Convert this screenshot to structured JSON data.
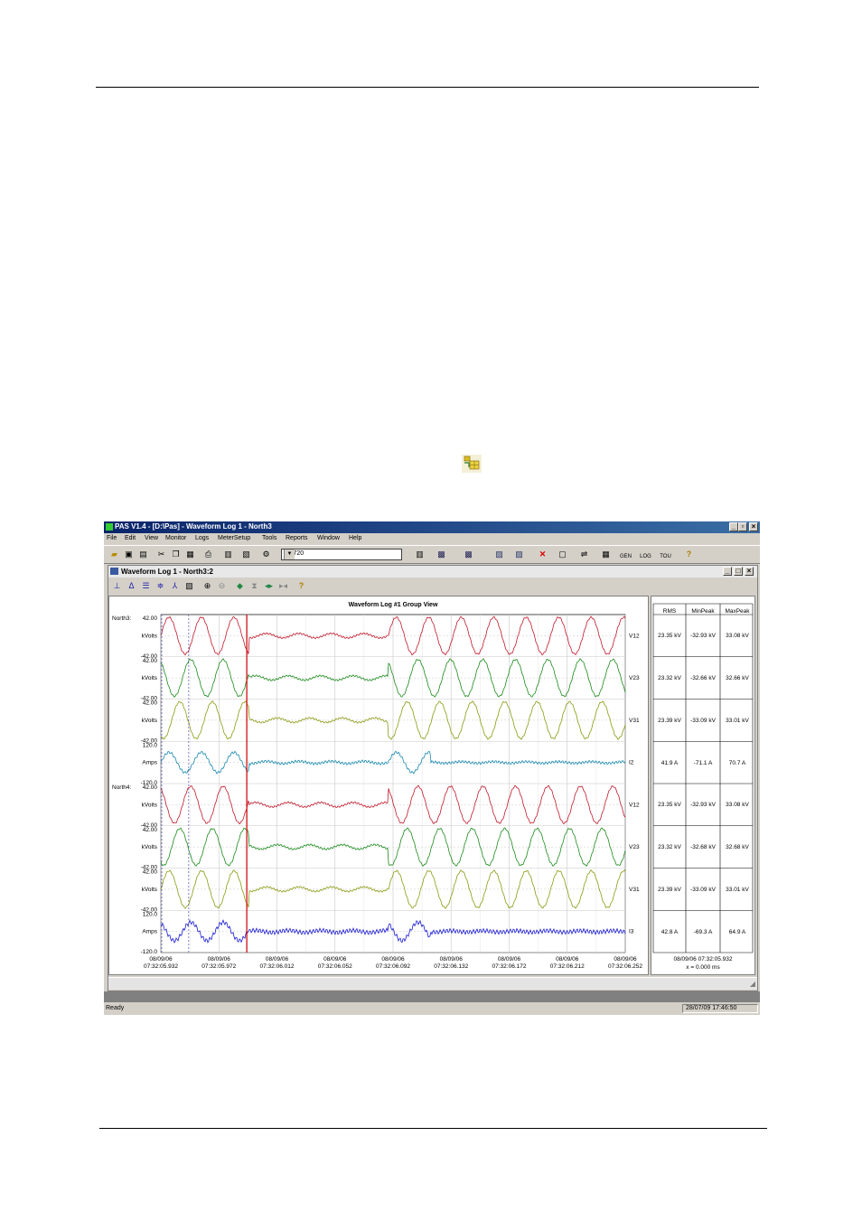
{
  "app": {
    "title": "PAS V1.4 - [D:\\Pas] - Waveform Log 1 - North3",
    "menu": [
      "File",
      "Edit",
      "View",
      "Monitor",
      "Logs",
      "MeterSetup",
      "Tools",
      "Reports",
      "Window",
      "Help"
    ],
    "device_combo": "EM720",
    "toolbar_icons": [
      "open-icon",
      "save-icon",
      "save-all-icon",
      "cut-icon",
      "copy-icon",
      "paste-icon",
      "print-icon",
      "preview-icon",
      "properties-icon",
      "connect-icon",
      "meter-icon",
      "download-icon",
      "upload-icon",
      "chart-icon",
      "image-icon",
      "delete-icon",
      "stop-icon",
      "network-icon",
      "grid-icon",
      "gen-icon",
      "log-icon",
      "tou-icon",
      "help-icon"
    ],
    "toolbar_labels": {
      "gen": "GEN",
      "log": "LOG",
      "tou": "TOU"
    }
  },
  "child_window": {
    "title": "Waveform Log 1 - North3:2"
  },
  "plot": {
    "title": "Waveform Log #1 Group View",
    "groups": [
      "North3",
      "North4"
    ],
    "channels": [
      {
        "group": "North3",
        "unit": "kVolts",
        "max": "42.00",
        "min": "-42.00",
        "label": "V12",
        "color": "#c0182a",
        "amp": 1,
        "noise": 0.02,
        "rms": "23.35 kV",
        "minpeak": "-32.93 kV",
        "maxpeak": "33.08 kV"
      },
      {
        "group": "",
        "unit": "kVolts",
        "max": "42.00",
        "min": "-42.00",
        "label": "V23",
        "color": "#1a8a1a",
        "amp": 1,
        "noise": 0.02,
        "rms": "23.32 kV",
        "minpeak": "-32.66 kV",
        "maxpeak": "32.66 kV"
      },
      {
        "group": "",
        "unit": "kVolts",
        "max": "42.00",
        "min": "-42.00",
        "label": "V31",
        "color": "#8a9a10",
        "amp": 1,
        "noise": 0.02,
        "rms": "23.39 kV",
        "minpeak": "-33.09 kV",
        "maxpeak": "33.01 kV"
      },
      {
        "group": "",
        "unit": "Amps",
        "max": "120.0",
        "min": "-120.0",
        "label": "I2",
        "color": "#1a8ab0",
        "amp": 0.55,
        "noise": 0.03,
        "rms": "41.9 A",
        "minpeak": "-71.1 A",
        "maxpeak": "70.7 A"
      },
      {
        "group": "North4",
        "unit": "kVolts",
        "max": "42.00",
        "min": "-42.00",
        "label": "V12",
        "color": "#c0182a",
        "amp": 1,
        "noise": 0.02,
        "rms": "23.35 kV",
        "minpeak": "-32.93 kV",
        "maxpeak": "33.08 kV"
      },
      {
        "group": "",
        "unit": "kVolts",
        "max": "42.00",
        "min": "-42.00",
        "label": "V23",
        "color": "#1a8a1a",
        "amp": 1,
        "noise": 0.02,
        "rms": "23.32 kV",
        "minpeak": "-32.68 kV",
        "maxpeak": "32.68 kV"
      },
      {
        "group": "",
        "unit": "kVolts",
        "max": "42.00",
        "min": "-42.00",
        "label": "V31",
        "color": "#8a9a10",
        "amp": 1,
        "noise": 0.02,
        "rms": "23.39 kV",
        "minpeak": "-33.09 kV",
        "maxpeak": "33.01 kV"
      },
      {
        "group": "",
        "unit": "Amps",
        "max": "120.0",
        "min": "-120.0",
        "label": "I3",
        "color": "#1a1ad0",
        "amp": 0.5,
        "noise": 0.05,
        "rms": "42.8 A",
        "minpeak": "-69.3 A",
        "maxpeak": "64.9 A"
      }
    ],
    "x_ticks": [
      {
        "date": "08/09/06",
        "time": "07:32:05.932"
      },
      {
        "date": "08/09/06",
        "time": "07:32:05.972"
      },
      {
        "date": "08/09/06",
        "time": "07:32:06.012"
      },
      {
        "date": "08/09/06",
        "time": "07:32:06.052"
      },
      {
        "date": "08/09/06",
        "time": "07:32:06.092"
      },
      {
        "date": "08/09/06",
        "time": "07:32:06.132"
      },
      {
        "date": "08/09/06",
        "time": "07:32:06.172"
      },
      {
        "date": "08/09/06",
        "time": "07:32:06.212"
      },
      {
        "date": "08/09/06",
        "time": "07:32:06.252"
      }
    ]
  },
  "table": {
    "headers": [
      "RMS",
      "MinPeak",
      "MaxPeak"
    ],
    "cursor_time": "08/09/06  07:32:05.932",
    "delta": "x = 0.000 ms"
  },
  "status": {
    "ready": "Ready",
    "datetime": "28/07/09 17:46:50"
  }
}
